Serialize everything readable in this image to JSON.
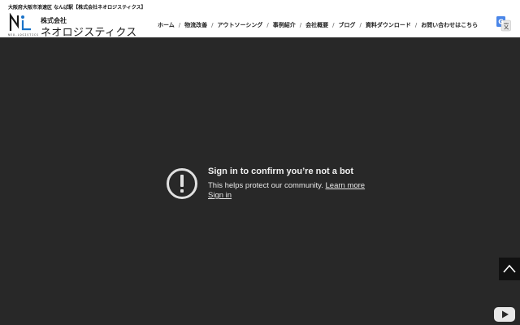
{
  "header": {
    "tagline": "大阪府大阪市浪速区 なんば駅【株式会社ネオロジスティクス】",
    "logo": {
      "company_type": "株式会社",
      "company_name": "ネオロジスティクス",
      "letter_mark": "N",
      "sub_text": "NEO-LOGISTICS"
    }
  },
  "nav": {
    "items": [
      {
        "label": "ホーム"
      },
      {
        "label": "物流改善"
      },
      {
        "label": "アウトソーシング"
      },
      {
        "label": "事例紹介"
      },
      {
        "label": "会社概要"
      },
      {
        "label": "ブログ"
      },
      {
        "label": "資料ダウンロード"
      },
      {
        "label": "お問い合わせはこちら"
      }
    ],
    "separator": "/"
  },
  "translate_icon": "google-translate-icon",
  "video": {
    "title": "Sign in to confirm you’re not a bot",
    "message": "This helps protect our community.",
    "learn_more": "Learn more",
    "sign_in": "Sign in",
    "icon": "alert-circle-icon",
    "background": "#282828"
  },
  "scroll_top_icon": "chevron-up-icon",
  "player_logo_icon": "youtube-icon"
}
